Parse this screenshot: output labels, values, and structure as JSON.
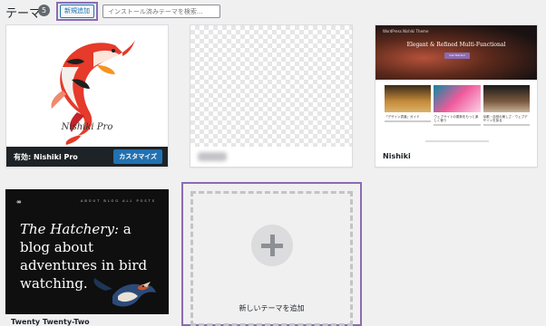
{
  "header": {
    "title": "テーマ",
    "count": "5",
    "add_new_label": "新規追加",
    "search_placeholder": "インストール済みテーマを検索..."
  },
  "themes": [
    {
      "name": "Nishiki Pro",
      "status_prefix": "有効:",
      "active": true,
      "customize_label": "カスタマイズ",
      "screenshot_brand": "Nishiki Pro"
    },
    {
      "name": "",
      "active": false
    },
    {
      "name": "Nishiki",
      "active": false,
      "preview": {
        "site_nav": "WordPress Nishiki Theme",
        "hero_title": "Elegant & Refined Multi-Functional",
        "hero_button": "Get Started",
        "captions": [
          "「デザイン書道」ガイド",
          "ウェブサイトの更新をもっと楽しく使う",
          "京都・自然の美しさ・ウェブデザインを探る"
        ]
      }
    },
    {
      "name": "Twenty Twenty-Two",
      "active": false,
      "preview": {
        "logo": "∞",
        "nav": "ABOUT  BLOG  ALL POSTS",
        "tagline_em": "The Hatchery:",
        "tagline_rest": " a blog about adventures in bird watching."
      }
    }
  ],
  "add_new_theme_label": "新しいテーマを追加",
  "colors": {
    "accent": "#2271b1",
    "highlight": "#8c6bb1",
    "active_bar": "#1d2327"
  }
}
